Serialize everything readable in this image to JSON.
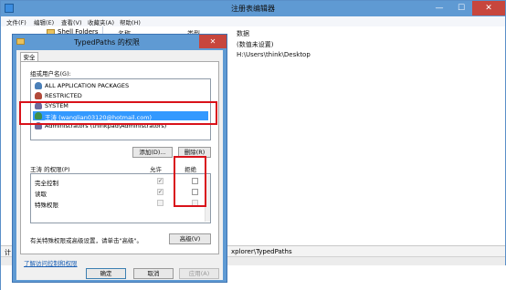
{
  "regedit": {
    "title": "注册表编辑器",
    "menu": [
      "文件(F)",
      "编辑(E)",
      "查看(V)",
      "收藏夹(A)",
      "帮助(H)"
    ],
    "tree": {
      "folder": "Shell Folders"
    },
    "list": {
      "columns": [
        "名称",
        "类型",
        "数据"
      ],
      "data_values": [
        "(数值未设置)",
        "H:\\Users\\think\\Desktop"
      ]
    },
    "status": {
      "prefix": "计",
      "path": "xplorer\\TypedPaths"
    },
    "window_buttons": {
      "min": "—",
      "max": "☐",
      "close": "✕"
    }
  },
  "dialog": {
    "title": "TypedPaths 的权限",
    "close": "✕",
    "tab": "安全",
    "groups_label": "组或用户名(G):",
    "users": [
      {
        "name": "ALL APPLICATION PACKAGES",
        "icon": "package-user-icon",
        "color": "#4a7fb8"
      },
      {
        "name": "RESTRICTED",
        "icon": "group-icon",
        "color": "#b24a3a"
      },
      {
        "name": "SYSTEM",
        "icon": "group-icon",
        "color": "#6b6b9c"
      },
      {
        "name": "王涛 (wanglian03120@hotmail.com)",
        "icon": "user-icon",
        "color": "#3e8f4a",
        "selected": true
      },
      {
        "name": "Administrators (thinkpad\\Administrators)",
        "icon": "group-icon",
        "color": "#6b6b9c"
      }
    ],
    "add_button": "添加(D)...",
    "remove_button": "删除(R)",
    "perm_label": "王涛 的权限(P)",
    "allow_header": "允许",
    "deny_header": "拒绝",
    "permissions": [
      {
        "name": "完全控制",
        "allow": "✓",
        "deny": ""
      },
      {
        "name": "读取",
        "allow": "✓",
        "deny": ""
      },
      {
        "name": "特殊权限",
        "allow": "",
        "deny": ""
      }
    ],
    "advanced_note": "有关特殊权限或高级设置，请单击\"高级\"。",
    "advanced_button": "高级(V)",
    "learn_link": "了解访问控制和权限",
    "ok_button": "确定",
    "cancel_button": "取消",
    "apply_button": "应用(A)"
  },
  "colors": {
    "highlight": "#d9121a",
    "selection": "#3399ff",
    "titlebar": "#5f9ad3",
    "close": "#c7463d"
  }
}
